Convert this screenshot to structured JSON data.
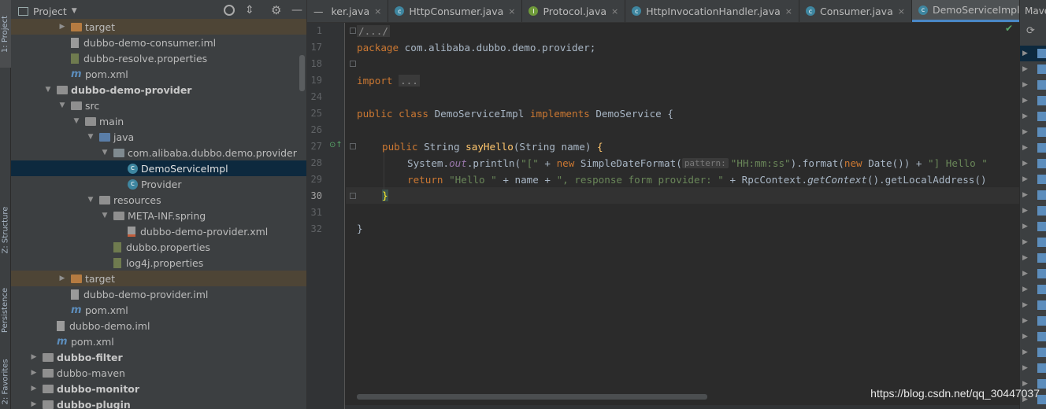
{
  "left_stripe": {
    "tabs": [
      {
        "label": "1: Project"
      },
      {
        "label": "Z: Structure"
      },
      {
        "label": "Persistence"
      },
      {
        "label": "2: Favorites"
      }
    ]
  },
  "project_panel": {
    "title": "Project",
    "tree": [
      {
        "label": "target",
        "depth": 3,
        "kind": "folder-orange",
        "expanded": false,
        "excluded": true
      },
      {
        "label": "dubbo-demo-consumer.iml",
        "depth": 3,
        "kind": "file"
      },
      {
        "label": "dubbo-resolve.properties",
        "depth": 3,
        "kind": "props"
      },
      {
        "label": "pom.xml",
        "depth": 3,
        "kind": "maven"
      },
      {
        "label": "dubbo-demo-provider",
        "depth": 2,
        "kind": "folder",
        "expanded": true,
        "bold": true
      },
      {
        "label": "src",
        "depth": 3,
        "kind": "folder",
        "expanded": true
      },
      {
        "label": "main",
        "depth": 4,
        "kind": "folder",
        "expanded": true
      },
      {
        "label": "java",
        "depth": 5,
        "kind": "folder-blue",
        "expanded": true
      },
      {
        "label": "com.alibaba.dubbo.demo.provider",
        "depth": 6,
        "kind": "package",
        "expanded": true
      },
      {
        "label": "DemoServiceImpl",
        "depth": 7,
        "kind": "class",
        "selected": true
      },
      {
        "label": "Provider",
        "depth": 7,
        "kind": "class"
      },
      {
        "label": "resources",
        "depth": 5,
        "kind": "folder",
        "expanded": true
      },
      {
        "label": "META-INF.spring",
        "depth": 6,
        "kind": "folder",
        "expanded": true
      },
      {
        "label": "dubbo-demo-provider.xml",
        "depth": 7,
        "kind": "xml"
      },
      {
        "label": "dubbo.properties",
        "depth": 6,
        "kind": "props"
      },
      {
        "label": "log4j.properties",
        "depth": 6,
        "kind": "props"
      },
      {
        "label": "target",
        "depth": 3,
        "kind": "folder-orange",
        "expanded": false,
        "excluded": true
      },
      {
        "label": "dubbo-demo-provider.iml",
        "depth": 3,
        "kind": "file"
      },
      {
        "label": "pom.xml",
        "depth": 3,
        "kind": "maven"
      },
      {
        "label": "dubbo-demo.iml",
        "depth": 2,
        "kind": "file"
      },
      {
        "label": "pom.xml",
        "depth": 2,
        "kind": "maven"
      },
      {
        "label": "dubbo-filter",
        "depth": 1,
        "kind": "folder",
        "expanded": false,
        "bold": true
      },
      {
        "label": "dubbo-maven",
        "depth": 1,
        "kind": "folder",
        "expanded": false
      },
      {
        "label": "dubbo-monitor",
        "depth": 1,
        "kind": "folder",
        "expanded": false,
        "bold": true
      },
      {
        "label": "dubbo-plugin",
        "depth": 1,
        "kind": "folder",
        "expanded": false,
        "bold": true
      }
    ]
  },
  "tabs": [
    {
      "label": "ker.java",
      "icon": "",
      "active": false
    },
    {
      "label": "HttpConsumer.java",
      "icon": "class",
      "active": false
    },
    {
      "label": "Protocol.java",
      "icon": "interface",
      "active": false
    },
    {
      "label": "HttpInvocationHandler.java",
      "icon": "class",
      "active": false
    },
    {
      "label": "Consumer.java",
      "icon": "class",
      "active": false
    },
    {
      "label": "DemoServiceImpl.java",
      "icon": "class",
      "active": true
    }
  ],
  "tab_overflow": "≡s",
  "right_panel": {
    "title": "Mave"
  },
  "editor": {
    "current_line": "30",
    "lines": [
      {
        "num": "1"
      },
      {
        "num": "17"
      },
      {
        "num": "18"
      },
      {
        "num": "19"
      },
      {
        "num": "24"
      },
      {
        "num": "25"
      },
      {
        "num": "26"
      },
      {
        "num": "27"
      },
      {
        "num": "28"
      },
      {
        "num": "29"
      },
      {
        "num": "30"
      },
      {
        "num": "31"
      },
      {
        "num": "32"
      }
    ],
    "code": {
      "l1_fold": "/.../",
      "l17_kw": "package",
      "l17_pkg": " com.alibaba.dubbo.demo.provider;",
      "l19_kw": "import",
      "l19_fold": "...",
      "l25_kw1": "public",
      "l25_kw2": "class",
      "l25_name": " DemoServiceImpl ",
      "l25_kw3": "implements",
      "l25_rest": " DemoService {",
      "l27_kw": "public",
      "l27_type": " String ",
      "l27_mth": "sayHello",
      "l27_params": "(String name) ",
      "l27_brace": "{",
      "l28_a": "System.",
      "l28_out": "out",
      "l28_b": ".println(",
      "l28_s1": "\"[\"",
      "l28_c": " + ",
      "l28_new": "new",
      "l28_d": " SimpleDateFormat(",
      "l28_hint": "pattern:",
      "l28_s2": "\"HH:mm:ss\"",
      "l28_e": ").format(",
      "l28_new2": "new",
      "l28_f": " Date()) + ",
      "l28_s3": "\"] Hello \"",
      "l29_ret": "return",
      "l29_s1": "\"Hello \"",
      "l29_a": " + name + ",
      "l29_s2": "\", response form provider: \"",
      "l29_b": " + RpcContext.",
      "l29_getctx": "getContext",
      "l29_c": "().getLocalAddress()",
      "l30_brace": "}",
      "l32_brace": "}"
    }
  },
  "watermark": "https://blog.csdn.net/qq_30447037"
}
